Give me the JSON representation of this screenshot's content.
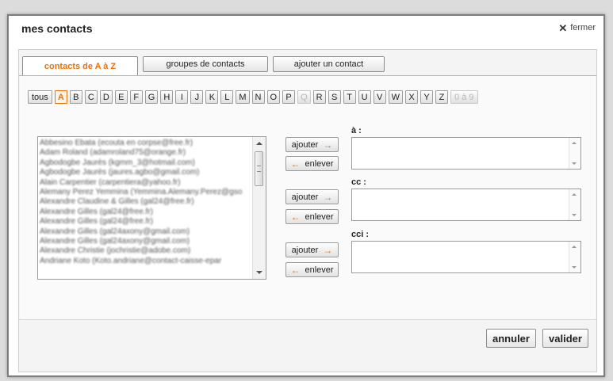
{
  "dialog": {
    "title": "mes contacts",
    "close_label": "fermer"
  },
  "tabs": [
    {
      "label": "contacts de A à Z",
      "active": true
    },
    {
      "label": "groupes de contacts",
      "active": false
    },
    {
      "label": "ajouter un contact",
      "active": false
    }
  ],
  "letters": [
    {
      "label": "tous",
      "state": "normal"
    },
    {
      "label": "A",
      "state": "selected"
    },
    {
      "label": "B",
      "state": "normal"
    },
    {
      "label": "C",
      "state": "normal"
    },
    {
      "label": "D",
      "state": "normal"
    },
    {
      "label": "E",
      "state": "normal"
    },
    {
      "label": "F",
      "state": "normal"
    },
    {
      "label": "G",
      "state": "normal"
    },
    {
      "label": "H",
      "state": "normal"
    },
    {
      "label": "I",
      "state": "normal"
    },
    {
      "label": "J",
      "state": "normal"
    },
    {
      "label": "K",
      "state": "normal"
    },
    {
      "label": "L",
      "state": "normal"
    },
    {
      "label": "M",
      "state": "normal"
    },
    {
      "label": "N",
      "state": "normal"
    },
    {
      "label": "O",
      "state": "normal"
    },
    {
      "label": "P",
      "state": "normal"
    },
    {
      "label": "Q",
      "state": "disabled"
    },
    {
      "label": "R",
      "state": "normal"
    },
    {
      "label": "S",
      "state": "normal"
    },
    {
      "label": "T",
      "state": "normal"
    },
    {
      "label": "U",
      "state": "normal"
    },
    {
      "label": "V",
      "state": "normal"
    },
    {
      "label": "W",
      "state": "normal"
    },
    {
      "label": "X",
      "state": "normal"
    },
    {
      "label": "Y",
      "state": "normal"
    },
    {
      "label": "Z",
      "state": "normal"
    },
    {
      "label": "0 à 9",
      "state": "disabled"
    }
  ],
  "contacts": [
    "Abbesino Ebata (ecouta en corpse@free.fr)",
    "Adam Roland (adamroland75@orange.fr)",
    "Agbodogbe Jaurès (kgmm_3@hotmail.com)",
    "Agbodogbe Jaurès (jaures.agbo@gmail.com)",
    "Alain Carpentier (carpentiera@yahoo.fr)",
    "Alemany Perez Yemmina (Yemmina.Alemany.Perez@gso",
    "Alexandre Claudine & Gilles (gal24@free.fr)",
    "Alexandre Gilles (gal24@free.fr)",
    "Alexandre Gilles (gal24@free.fr)",
    "Alexandre Gilles (gal24axony@gmail.com)",
    "Alexandre Gilles (gal24axony@gmail.com)",
    "Alexandre Christie (jochristie@adobe.com)",
    "Andriane Koto (Koto.andriane@contact-caisse-epar"
  ],
  "recipients": {
    "to_label": "à :",
    "cc_label": "cc :",
    "bcc_label": "cci :",
    "add_label": "ajouter",
    "remove_label": "enlever",
    "to_value": "",
    "cc_value": "",
    "bcc_value": ""
  },
  "footer": {
    "cancel_label": "annuler",
    "ok_label": "valider"
  },
  "colors": {
    "accent": "#e8720c"
  }
}
